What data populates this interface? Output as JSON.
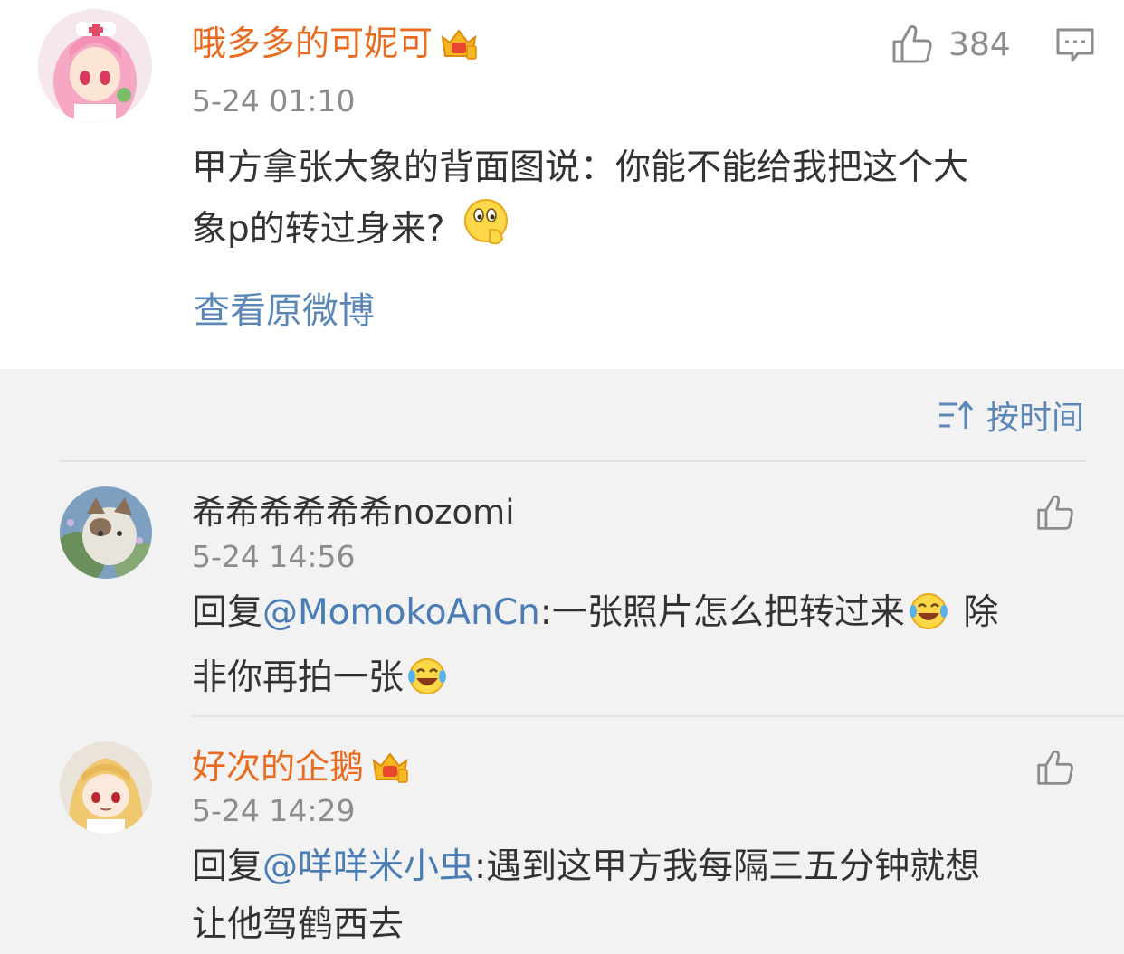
{
  "post": {
    "author": "哦多多的可妮可",
    "time": "5-24 01:10",
    "like_count": "384",
    "text_line1": "甲方拿张大象的背面图说：你能不能给我把这个大",
    "text_line2": "象p的转过身来?",
    "view_original": "查看原微博",
    "author_badge": "crown-icon",
    "emoji": "thinking-emoji"
  },
  "sort": {
    "label": "按时间",
    "icon": "sort-icon"
  },
  "comments": [
    {
      "author": "希希希希希希nozomi",
      "time": "5-24 14:56",
      "reply_prefix": "回复",
      "mention": "@MomokoAnCn",
      "line1": ":一张照片怎么把转过来",
      "line1_tail": " 除",
      "line2": "非你再拍一张",
      "emoji": "laughing-crying-emoji"
    },
    {
      "author": "好次的企鹅",
      "time": "5-24 14:29",
      "reply_prefix": "回复",
      "mention": "@咩咩米小虫",
      "line1": ":遇到这甲方我每隔三五分钟就想",
      "line2": "让他驾鹤西去",
      "author_badge": "crown-icon"
    }
  ],
  "colors": {
    "username_vip": "#e86b1f",
    "link": "#5b86b8",
    "mention": "#4a7cb5",
    "timestamp": "#8c8c8c",
    "background": "#f2f2f2"
  }
}
